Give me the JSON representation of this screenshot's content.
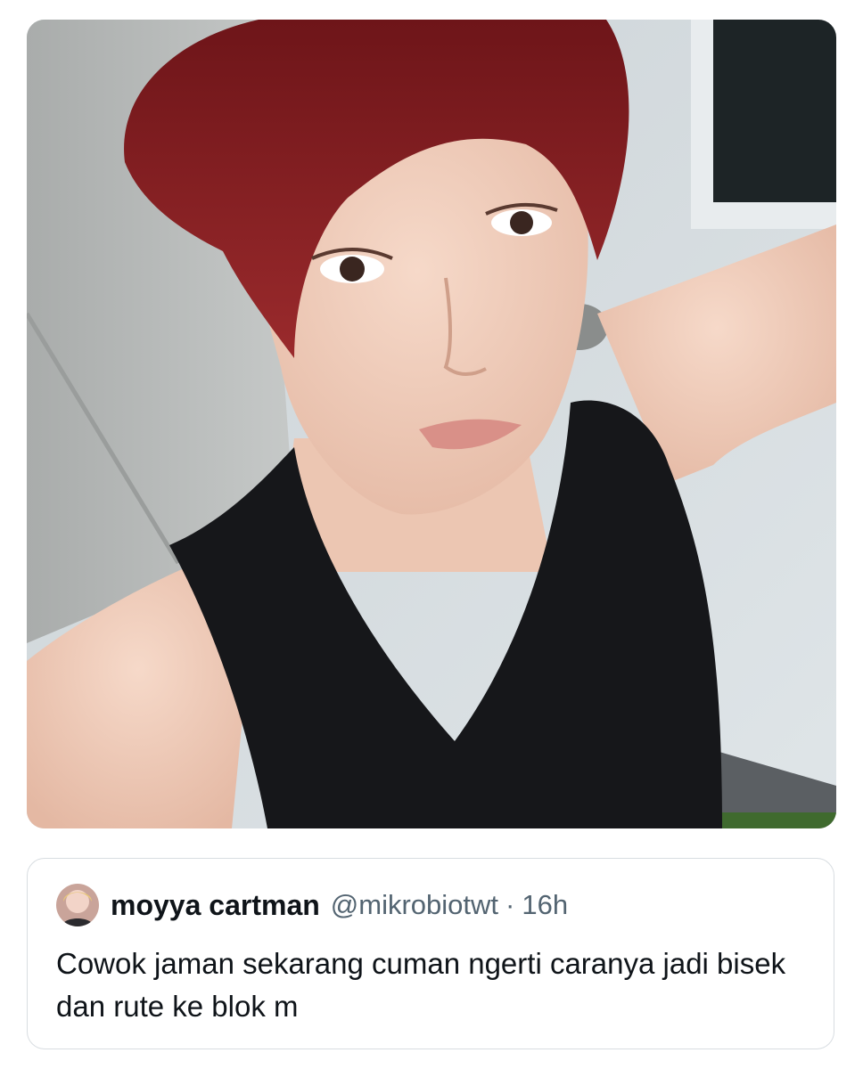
{
  "tweet": {
    "media": {
      "kind": "photo",
      "icon": "photo-selfie"
    }
  },
  "quote": {
    "author_name": "moyya cartman",
    "author_handle": "@mikrobiotwt",
    "separator": "·",
    "time": "16h",
    "text": "Cowok jaman sekarang cuman ngerti caranya jadi bisek dan rute ke blok m"
  },
  "colors": {
    "text_primary": "#0f1419",
    "text_secondary": "#536471",
    "border": "#d8dde1",
    "hair": "#8a1f24"
  }
}
